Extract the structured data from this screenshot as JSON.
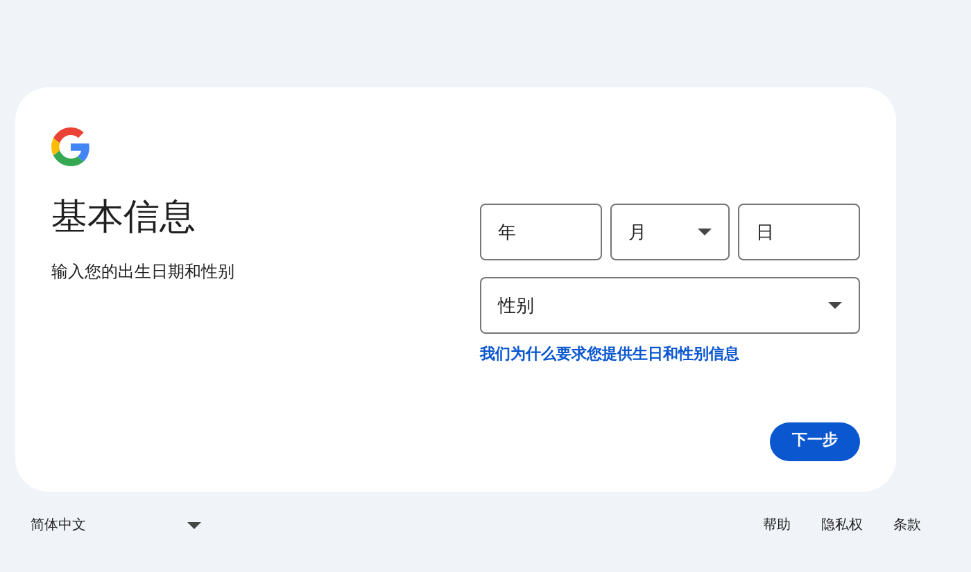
{
  "card": {
    "title": "基本信息",
    "subtitle": "输入您的出生日期和性别",
    "date_fields": [
      {
        "kind": "input",
        "placeholder": "年"
      },
      {
        "kind": "select",
        "placeholder": "月"
      },
      {
        "kind": "input",
        "placeholder": "日"
      }
    ],
    "gender_field": {
      "kind": "select",
      "placeholder": "性别"
    },
    "help_link": "我们为什么要求您提供生日和性别信息",
    "next_button": "下一步"
  },
  "footer": {
    "language": "简体中文",
    "links": [
      "帮助",
      "隐私权",
      "条款"
    ]
  }
}
